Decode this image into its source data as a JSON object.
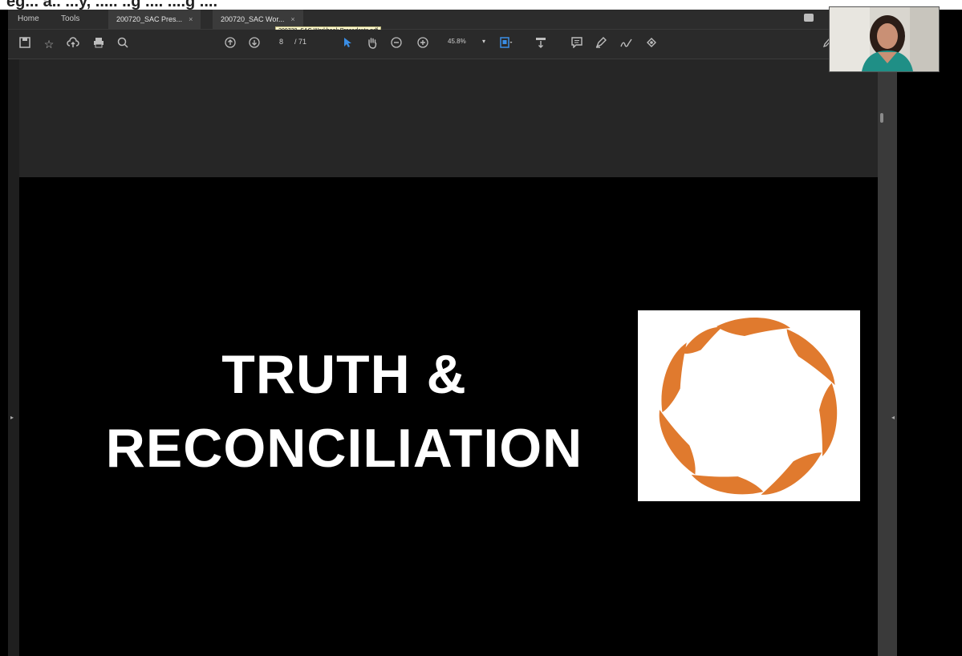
{
  "header_cropped_text": "eg... a.. ...y, ..... ..g .... ....g ....",
  "tabs": {
    "home": "Home",
    "tools": "Tools",
    "doc1": "200720_SAC Pres...",
    "doc2": "200720_SAC Wor...",
    "close": "×"
  },
  "tooltip": "200720_SAC Workbook Precedents.pdf",
  "toolbar": {
    "page_current": "8",
    "page_total": "/ 71",
    "zoom": "45.8%",
    "zoom_dropdown": "▾"
  },
  "slide": {
    "title_line1": "TRUTH &",
    "title_line2": "RECONCILIATION"
  },
  "colors": {
    "logo_orange": "#E07A2E",
    "app_bg": "#1f1f1f"
  }
}
